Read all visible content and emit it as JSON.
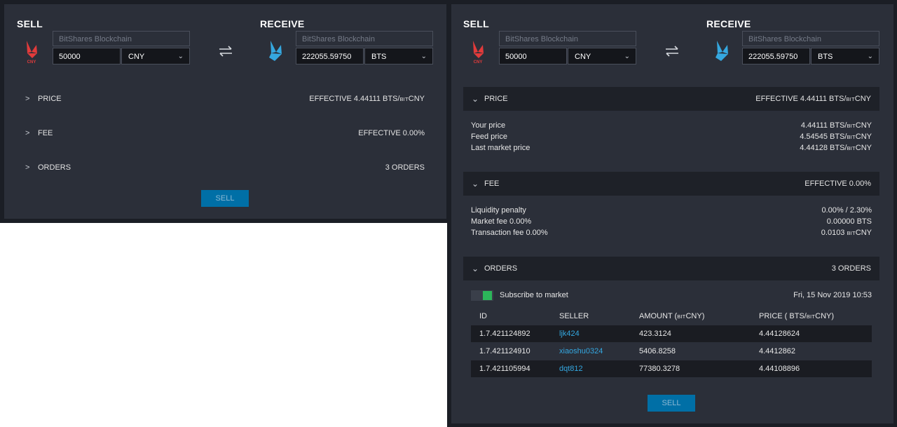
{
  "left": {
    "sell_title": "SELL",
    "receive_title": "RECEIVE",
    "sell_logo_text": "CNY",
    "sell_chain_placeholder": "BitShares Blockchain",
    "sell_amount": "50000",
    "sell_asset": "CNY",
    "receive_chain_placeholder": "BitShares Blockchain",
    "receive_amount": "222055.59750",
    "receive_asset": "BTS",
    "price_label": "PRICE",
    "price_value_prefix": "EFFECTIVE 4.44111 BTS/",
    "bit": "BIT",
    "price_value_suffix": "CNY",
    "fee_label": "FEE",
    "fee_value": "EFFECTIVE 0.00%",
    "orders_label": "ORDERS",
    "orders_value": "3 ORDERS",
    "sell_button": "SELL"
  },
  "right": {
    "sell_title": "SELL",
    "receive_title": "RECEIVE",
    "sell_logo_text": "CNY",
    "sell_chain_placeholder": "BitShares Blockchain",
    "sell_amount": "50000",
    "sell_asset": "CNY",
    "receive_chain_placeholder": "BitShares Blockchain",
    "receive_amount": "222055.59750",
    "receive_asset": "BTS",
    "price_label": "PRICE",
    "price_value_prefix": "EFFECTIVE 4.44111 BTS/",
    "bit": "BIT",
    "price_value_suffix": "CNY",
    "price_details": [
      {
        "label": "Your price",
        "value_prefix": "4.44111 BTS/",
        "value_suffix": "CNY"
      },
      {
        "label": "Feed price",
        "value_prefix": "4.54545 BTS/",
        "value_suffix": "CNY"
      },
      {
        "label": "Last market price",
        "value_prefix": "4.44128 BTS/",
        "value_suffix": "CNY"
      }
    ],
    "fee_label": "FEE",
    "fee_value": "EFFECTIVE 0.00%",
    "fee_details": [
      {
        "label": "Liquidity penalty",
        "value": "0.00% / 2.30%"
      },
      {
        "label": "Market fee 0.00%",
        "value": "0.00000 BTS"
      },
      {
        "label": "Transaction fee 0.00%",
        "value_prefix": "0.0103 ",
        "value_suffix": "CNY"
      }
    ],
    "orders_label": "ORDERS",
    "orders_value": "3 ORDERS",
    "subscribe_label": "Subscribe to market",
    "timestamp": "Fri, 15 Nov 2019 10:53",
    "table_headers": {
      "id": "ID",
      "seller": "SELLER",
      "amount_prefix": "AMOUNT (",
      "amount_suffix": "CNY)",
      "price_prefix": "PRICE ( BTS/",
      "price_suffix": "CNY)"
    },
    "orders": [
      {
        "id": "1.7.421124892",
        "seller": "ljk424",
        "amount": "423.3124",
        "price": "4.44128624"
      },
      {
        "id": "1.7.421124910",
        "seller": "xiaoshu0324",
        "amount": "5406.8258",
        "price": "4.4412862"
      },
      {
        "id": "1.7.421105994",
        "seller": "dqt812",
        "amount": "77380.3278",
        "price": "4.44108896"
      }
    ],
    "sell_button": "SELL"
  },
  "colors": {
    "panel": "#2b2f39",
    "bar": "#1e2128",
    "accent_button": "#006fa6",
    "seller_link": "#34a7e0",
    "toggle_on": "#2cb65a",
    "cny_logo": "#e23b3b",
    "bts_logo": "#35a8e0"
  },
  "icons": [
    "cny-logo-icon",
    "bts-logo-icon",
    "swap-arrows-icon",
    "chevron-right-icon",
    "chevron-down-icon"
  ]
}
